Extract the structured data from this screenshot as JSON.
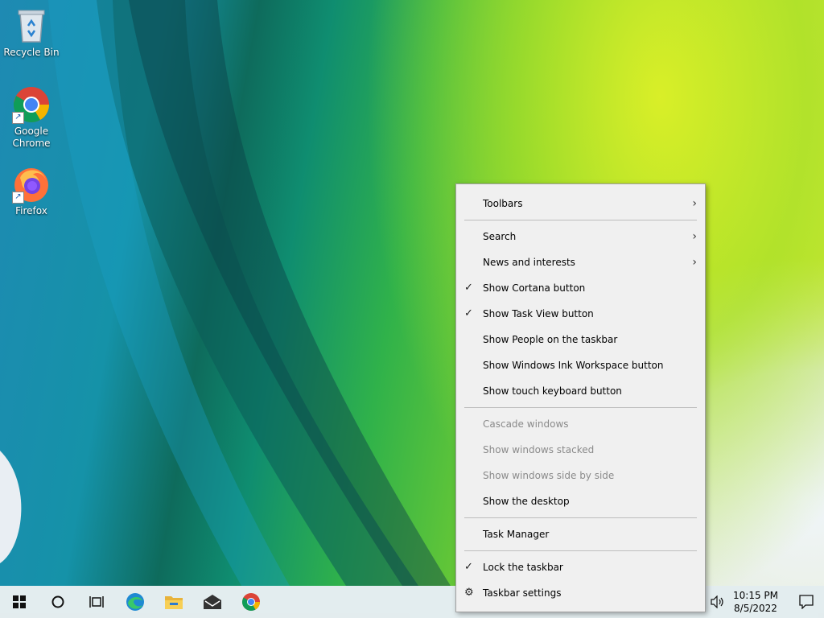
{
  "desktop": {
    "icons": [
      {
        "label": "Recycle Bin"
      },
      {
        "label": "Google\nChrome"
      },
      {
        "label": "Firefox"
      }
    ]
  },
  "context_menu": {
    "toolbars": "Toolbars",
    "search": "Search",
    "news": "News and interests",
    "cortana": "Show Cortana button",
    "taskview": "Show Task View button",
    "people": "Show People on the taskbar",
    "ink": "Show Windows Ink Workspace button",
    "touch_keyboard": "Show touch keyboard button",
    "cascade": "Cascade windows",
    "stacked": "Show windows stacked",
    "side_by_side": "Show windows side by side",
    "show_desktop": "Show the desktop",
    "task_manager": "Task Manager",
    "lock": "Lock the taskbar",
    "taskbar_settings": "Taskbar settings",
    "check_glyph": "✓",
    "submenu_glyph": "›"
  },
  "taskbar": {
    "time": "10:15 PM",
    "date": "8/5/2022",
    "pinned": [
      "start-icon",
      "cortana-icon",
      "task-view-icon",
      "edge-icon",
      "file-explorer-icon",
      "mail-icon",
      "chrome-icon"
    ]
  }
}
